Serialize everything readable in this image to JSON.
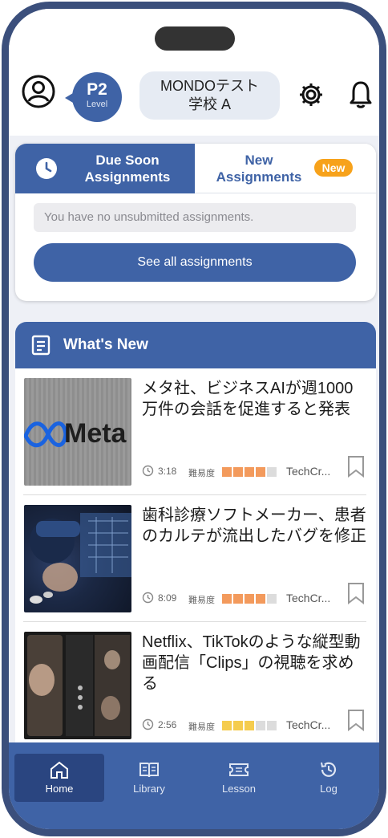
{
  "header": {
    "level_code": "P2",
    "level_sub": "Level",
    "school_line1": "MONDOテスト",
    "school_line2": "学校 A"
  },
  "assignments": {
    "tab_due_line1": "Due Soon",
    "tab_due_line2": "Assignments",
    "tab_new_line1": "New",
    "tab_new_line2": "Assignments",
    "new_badge": "New",
    "empty_message": "You have no unsubmitted assignments.",
    "see_all_label": "See all assignments"
  },
  "whats_new": {
    "title": "What's New",
    "articles": [
      {
        "title": "メタ社、ビジネスAIが週1000万件の会話を促進すると発表",
        "duration": "3:18",
        "difficulty_label": "難易度",
        "difficulty_level": 4,
        "difficulty_color": "#f39a5c",
        "source": "TechCr..."
      },
      {
        "title": "歯科診療ソフトメーカー、患者のカルテが流出したバグを修正",
        "duration": "8:09",
        "difficulty_label": "難易度",
        "difficulty_level": 4,
        "difficulty_color": "#f39a5c",
        "source": "TechCr..."
      },
      {
        "title": "Netflix、TikTokのような縦型動画配信「Clips」の視聴を求める",
        "duration": "2:56",
        "difficulty_label": "難易度",
        "difficulty_level": 3,
        "difficulty_color": "#f5cc4e",
        "source": "TechCr..."
      }
    ]
  },
  "nav": {
    "items": [
      {
        "label": "Home",
        "icon": "home-icon"
      },
      {
        "label": "Library",
        "icon": "book-icon"
      },
      {
        "label": "Lesson",
        "icon": "ticket-icon"
      },
      {
        "label": "Log",
        "icon": "history-icon"
      }
    ]
  },
  "colors": {
    "primary": "#3f63a6",
    "frame": "#3b4f7c",
    "badge": "#f7a21b"
  }
}
